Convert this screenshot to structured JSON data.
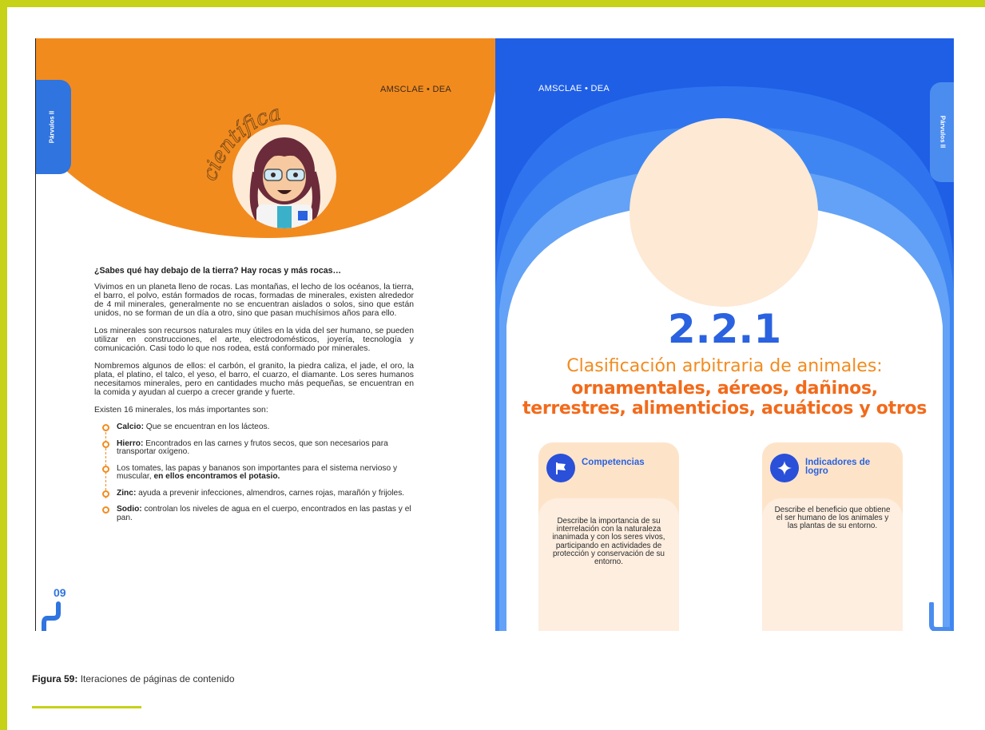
{
  "left_page": {
    "tab_label": "Párvulos II",
    "header": "AMSCLAE  •  DEA",
    "badge_word": "científica",
    "question": "¿Sabes qué hay debajo de la tierra? Hay rocas y más rocas…",
    "paragraphs": [
      "Vivimos en un planeta lleno de rocas. Las montañas, el lecho de los océanos, la tierra, el barro, el polvo, están formados de rocas, formadas de minerales, existen alrededor de 4 mil minerales, generalmente no se encuentran aislados o solos, sino que están unidos, no se forman de un día a otro, sino que pasan muchísimos años para ello.",
      "Los minerales son recursos naturales muy útiles en la vida del ser humano, se pueden utilizar en construcciones, el arte, electrodomésticos, joyería, tecnología y comunicación. Casi todo lo que nos rodea, está conformado por minerales.",
      "Nombremos algunos de ellos: el carbón, el granito, la piedra caliza, el jade, el oro, la plata, el platino, el talco, el yeso, el barro, el cuarzo, el diamante. Los seres humanos necesitamos minerales, pero en cantidades mucho más pequeñas, se encuentran en la comida y ayudan al cuerpo a crecer grande y fuerte.",
      "Existen 16 minerales, los más importantes son:"
    ],
    "bullets": [
      {
        "bold": "Calcio:",
        "text": " Que se encuentran en los lácteos.",
        "bold_end": ""
      },
      {
        "bold": "Hierro:",
        "text": " Encontrados en las carnes y frutos secos, que son necesarios para transportar oxígeno.",
        "bold_end": ""
      },
      {
        "bold": "",
        "text": "Los tomates, las papas y bananos son importantes para el sistema nervioso y muscular, ",
        "bold_end": "en ellos encontramos el potasio."
      },
      {
        "bold": "Zinc:",
        "text": " ayuda a prevenir infecciones, almendros, carnes rojas, marañón y frijoles.",
        "bold_end": ""
      },
      {
        "bold": "Sodio:",
        "text": " controlan los niveles de agua en el cuerpo, encontrados en las pastas y el pan.",
        "bold_end": ""
      }
    ],
    "page_number": "09"
  },
  "right_page": {
    "header": "AMSCLAE  •  DEA",
    "tab_label": "Párvulos II",
    "lesson_number": "2.2.1",
    "subtitle": "Clasificación arbitraria de animales:",
    "title": "ornamentales, aéreos, dañinos, terrestres, alimenticios, acuáticos y otros",
    "cards": [
      {
        "heading": "Competencias",
        "icon": "flag-icon",
        "body": "Describe la importancia de su interrelación con la naturaleza inanimada y con los seres vivos, participando en actividades de protección y conservación de su entorno."
      },
      {
        "heading": "Indicadores de logro",
        "icon": "sparkle-icon",
        "body": "Describe el beneficio que obtiene el ser humano de los animales y las plantas de su entorno."
      }
    ]
  },
  "caption": {
    "label": "Figura 59:",
    "text": " Iteraciones de páginas de contenido"
  },
  "colors": {
    "frame": "#c6d217",
    "orange": "#f28b1e",
    "blue": "#2a62e0"
  }
}
